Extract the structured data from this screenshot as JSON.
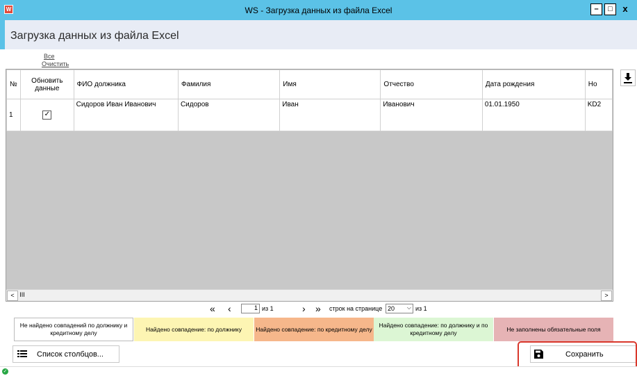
{
  "window": {
    "title": "WS - Загрузка данных из файла Excel",
    "app_icon": "excel-icon",
    "minimize": "–",
    "maximize": "□",
    "close": "x"
  },
  "header": {
    "title": "Загрузка данных из файла Excel"
  },
  "select_links": {
    "all": "Все",
    "clear": "Очистить"
  },
  "table": {
    "columns": [
      "№",
      "Обновить данные",
      "ФИО должника",
      "Фамилия",
      "Имя",
      "Отчество",
      "Дата рождения",
      "Ho"
    ],
    "rows": [
      {
        "num": "1",
        "update_checked": true,
        "check_mark": "✓",
        "fio": "Сидоров Иван Иванович",
        "last": "Сидоров",
        "first": "Иван",
        "middle": "Иванович",
        "birth": "01.01.1950",
        "extra": "KD2"
      }
    ]
  },
  "scrollbar": {
    "left": "<",
    "thumb": "III",
    "right": ">"
  },
  "pager": {
    "first": "«",
    "prev": "‹",
    "page": "1",
    "of_pages": "из 1",
    "next": "›",
    "last": "»",
    "rows_per_page_label": "строк на странице",
    "rows_per_page": "20",
    "of_total": "из 1"
  },
  "legend": [
    {
      "text": "Не найдено совпадений по должнику и кредитному делу",
      "color": "#ffffff"
    },
    {
      "text": "Найдено совпадение: по должнику",
      "color": "#fdf5b3"
    },
    {
      "text": "Найдено совпадение: по кредитному делу",
      "color": "#f6b78b"
    },
    {
      "text": "Найдено совпадение: по должнику и по кредитному делу",
      "color": "#dcf6d4"
    },
    {
      "text": "Не заполнены обязательные поля",
      "color": "#e6b3b5"
    }
  ],
  "buttons": {
    "columns_list": "Список столбцов...",
    "save": "Сохранить"
  },
  "colors": {
    "titlebar": "#5bc2e7",
    "header_bg": "#e8ecf5",
    "highlight": "#d9372b",
    "status_ok": "#28a745"
  }
}
